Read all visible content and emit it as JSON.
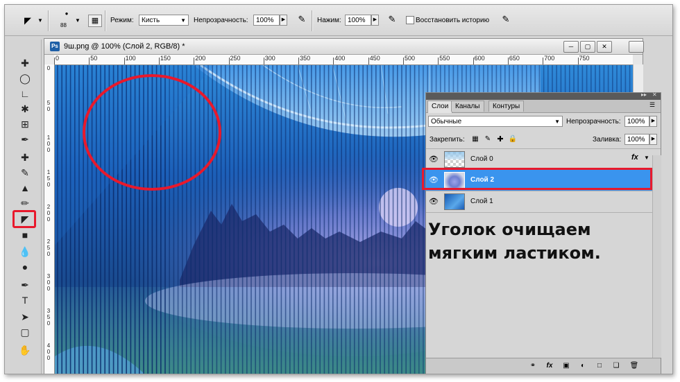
{
  "options_bar": {
    "brush_size": "88",
    "mode_label": "Режим:",
    "mode_value": "Кисть",
    "opacity_label": "Непрозрачность:",
    "opacity_value": "100%",
    "flow_label": "Нажим:",
    "flow_value": "100%",
    "erase_history_label": "Восстановить историю"
  },
  "document": {
    "title": "9ш.png @ 100% (Слой 2, RGB/8) *",
    "ps_badge": "Ps",
    "ruler_h": [
      "0",
      "50",
      "100",
      "150",
      "200",
      "250",
      "300",
      "350",
      "400",
      "450",
      "500",
      "550",
      "600",
      "650",
      "700",
      "750"
    ],
    "ruler_v": [
      [
        "0"
      ],
      [
        "5",
        "0"
      ],
      [
        "1",
        "0",
        "0"
      ],
      [
        "1",
        "5",
        "0"
      ],
      [
        "2",
        "0",
        "0"
      ],
      [
        "2",
        "5",
        "0"
      ],
      [
        "3",
        "0",
        "0"
      ],
      [
        "3",
        "5",
        "0"
      ],
      [
        "4",
        "0",
        "0"
      ]
    ]
  },
  "layers_panel": {
    "tabs": [
      {
        "label": "Слои",
        "active": true
      },
      {
        "label": "Каналы",
        "active": false
      },
      {
        "label": "Контуры",
        "active": false
      }
    ],
    "blend_mode": "Обычные",
    "opacity_label": "Непрозрачность:",
    "opacity_value": "100%",
    "lock_label": "Закрепить:",
    "fill_label": "Заливка:",
    "fill_value": "100%",
    "layers": [
      {
        "name": "Слой 0",
        "selected": false,
        "fx": "fx"
      },
      {
        "name": "Слой 2",
        "selected": true
      },
      {
        "name": "Слой 1",
        "selected": false
      }
    ],
    "annotation": "Уголок очищаем мягким ластиком."
  },
  "colors": {
    "highlight": "#e8192c",
    "selection": "#3a94ee",
    "canvas_blue": "#1e6cc2"
  }
}
